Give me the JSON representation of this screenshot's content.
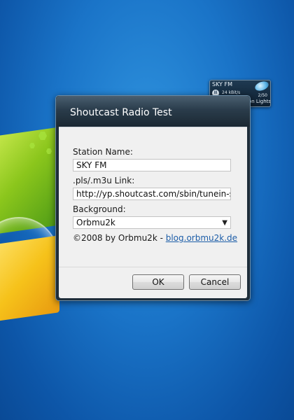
{
  "gadget": {
    "station": "SKY FM",
    "play_icon": "pause-icon",
    "bitrate": "24 kBit/s",
    "counter": "2/50",
    "track": "ımi Lovato - Neon Lights (C"
  },
  "dialog": {
    "title": "Shoutcast Radio Test",
    "station_label": "Station Name:",
    "station_value": "SKY FM",
    "link_label": ".pls/.m3u Link:",
    "link_value": "http://yp.shoutcast.com/sbin/tunein-sta",
    "background_label": "Background:",
    "background_value": "Orbmu2k",
    "copyright": "©2008 by Orbmu2k - ",
    "blog_link": "blog.orbmu2k.de",
    "ok_label": "OK",
    "cancel_label": "Cancel"
  }
}
